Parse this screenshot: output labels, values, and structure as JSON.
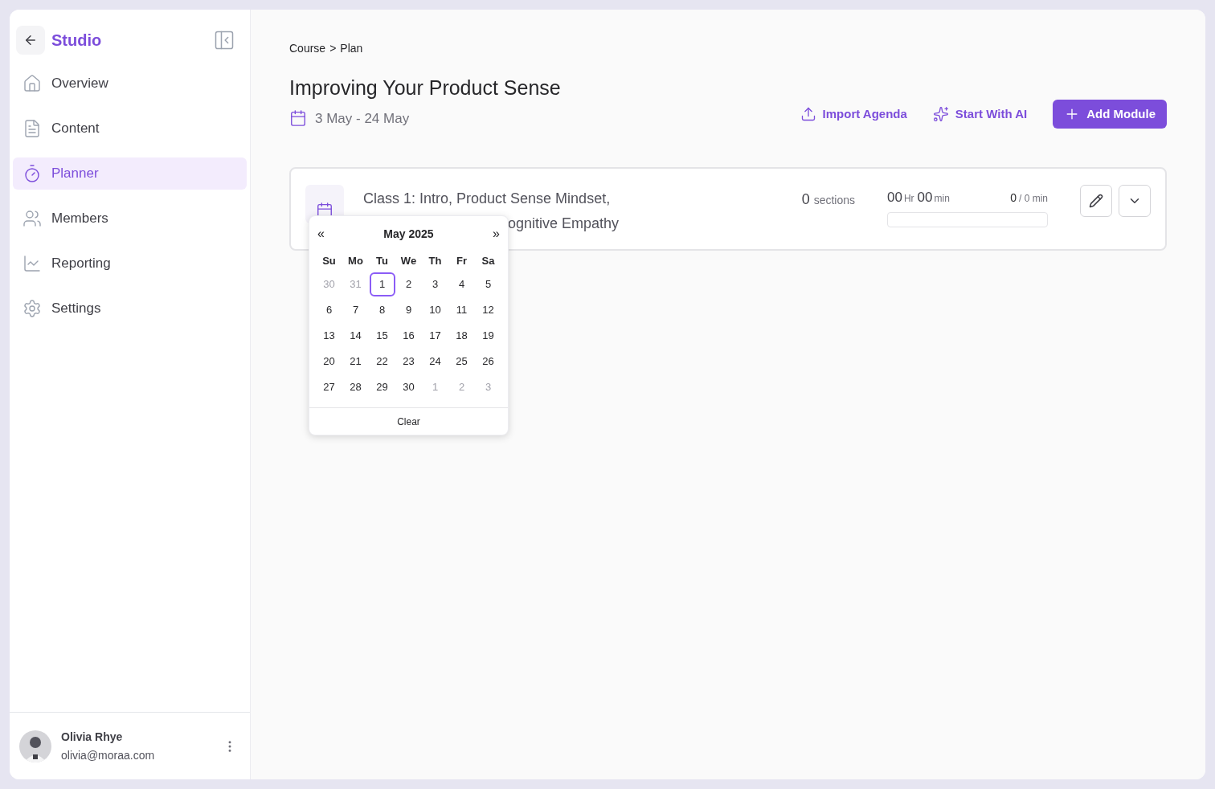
{
  "sidebar": {
    "title": "Studio",
    "items": [
      {
        "label": "Overview",
        "selected": false
      },
      {
        "label": "Content",
        "selected": false
      },
      {
        "label": "Planner",
        "selected": true
      },
      {
        "label": "Members",
        "selected": false
      },
      {
        "label": "Reporting",
        "selected": false
      },
      {
        "label": "Settings",
        "selected": false
      }
    ],
    "user": {
      "name": "Olivia Rhye",
      "email": "olivia@moraa.com"
    }
  },
  "breadcrumb": [
    "Course",
    "Plan"
  ],
  "breadcrumb_separator": ">",
  "page_title": "Improving Your Product Sense",
  "date_range": "3 May - 24 May",
  "actions": [
    {
      "label": "Import Agenda",
      "kind": "link"
    },
    {
      "label": "Start With AI",
      "kind": "link"
    },
    {
      "label": "Add Module",
      "kind": "primary"
    }
  ],
  "module": {
    "title_line_1": "Class 1: Intro, Product Sense Mindset,",
    "title_line_2_visible": "ognitive Empathy",
    "sections_count": "0",
    "sections_label": "sections",
    "hours": "00",
    "hours_unit": "Hr",
    "minutes": "00",
    "minutes_unit": "min",
    "progress_done": "0",
    "progress_total": "/ 0 min",
    "level": 0
  },
  "calendar": {
    "prev": "«",
    "next": "»",
    "month": "May 2025",
    "weekdays": [
      "Su",
      "Mo",
      "Tu",
      "We",
      "Th",
      "Fr",
      "Sa"
    ],
    "weeks": [
      [
        {
          "label": "30",
          "outside": true,
          "selected": false
        },
        {
          "label": "31",
          "outside": true,
          "selected": false
        },
        {
          "label": "1",
          "outside": false,
          "selected": true
        },
        {
          "label": "2",
          "outside": false,
          "selected": false
        },
        {
          "label": "3",
          "outside": false,
          "selected": false
        },
        {
          "label": "4",
          "outside": false,
          "selected": false
        },
        {
          "label": "5",
          "outside": false,
          "selected": false
        }
      ],
      [
        {
          "label": "6",
          "outside": false,
          "selected": false
        },
        {
          "label": "7",
          "outside": false,
          "selected": false
        },
        {
          "label": "8",
          "outside": false,
          "selected": false
        },
        {
          "label": "9",
          "outside": false,
          "selected": false
        },
        {
          "label": "10",
          "outside": false,
          "selected": false
        },
        {
          "label": "11",
          "outside": false,
          "selected": false
        },
        {
          "label": "12",
          "outside": false,
          "selected": false
        }
      ],
      [
        {
          "label": "13",
          "outside": false,
          "selected": false
        },
        {
          "label": "14",
          "outside": false,
          "selected": false
        },
        {
          "label": "15",
          "outside": false,
          "selected": false
        },
        {
          "label": "16",
          "outside": false,
          "selected": false
        },
        {
          "label": "17",
          "outside": false,
          "selected": false
        },
        {
          "label": "18",
          "outside": false,
          "selected": false
        },
        {
          "label": "19",
          "outside": false,
          "selected": false
        }
      ],
      [
        {
          "label": "20",
          "outside": false,
          "selected": false
        },
        {
          "label": "21",
          "outside": false,
          "selected": false
        },
        {
          "label": "22",
          "outside": false,
          "selected": false
        },
        {
          "label": "23",
          "outside": false,
          "selected": false
        },
        {
          "label": "24",
          "outside": false,
          "selected": false
        },
        {
          "label": "25",
          "outside": false,
          "selected": false
        },
        {
          "label": "26",
          "outside": false,
          "selected": false
        }
      ],
      [
        {
          "label": "27",
          "outside": false,
          "selected": false
        },
        {
          "label": "28",
          "outside": false,
          "selected": false
        },
        {
          "label": "29",
          "outside": false,
          "selected": false
        },
        {
          "label": "30",
          "outside": false,
          "selected": false
        },
        {
          "label": "1",
          "outside": true,
          "selected": false
        },
        {
          "label": "2",
          "outside": true,
          "selected": false
        },
        {
          "label": "3",
          "outside": true,
          "selected": false
        }
      ]
    ],
    "clear": "Clear"
  }
}
